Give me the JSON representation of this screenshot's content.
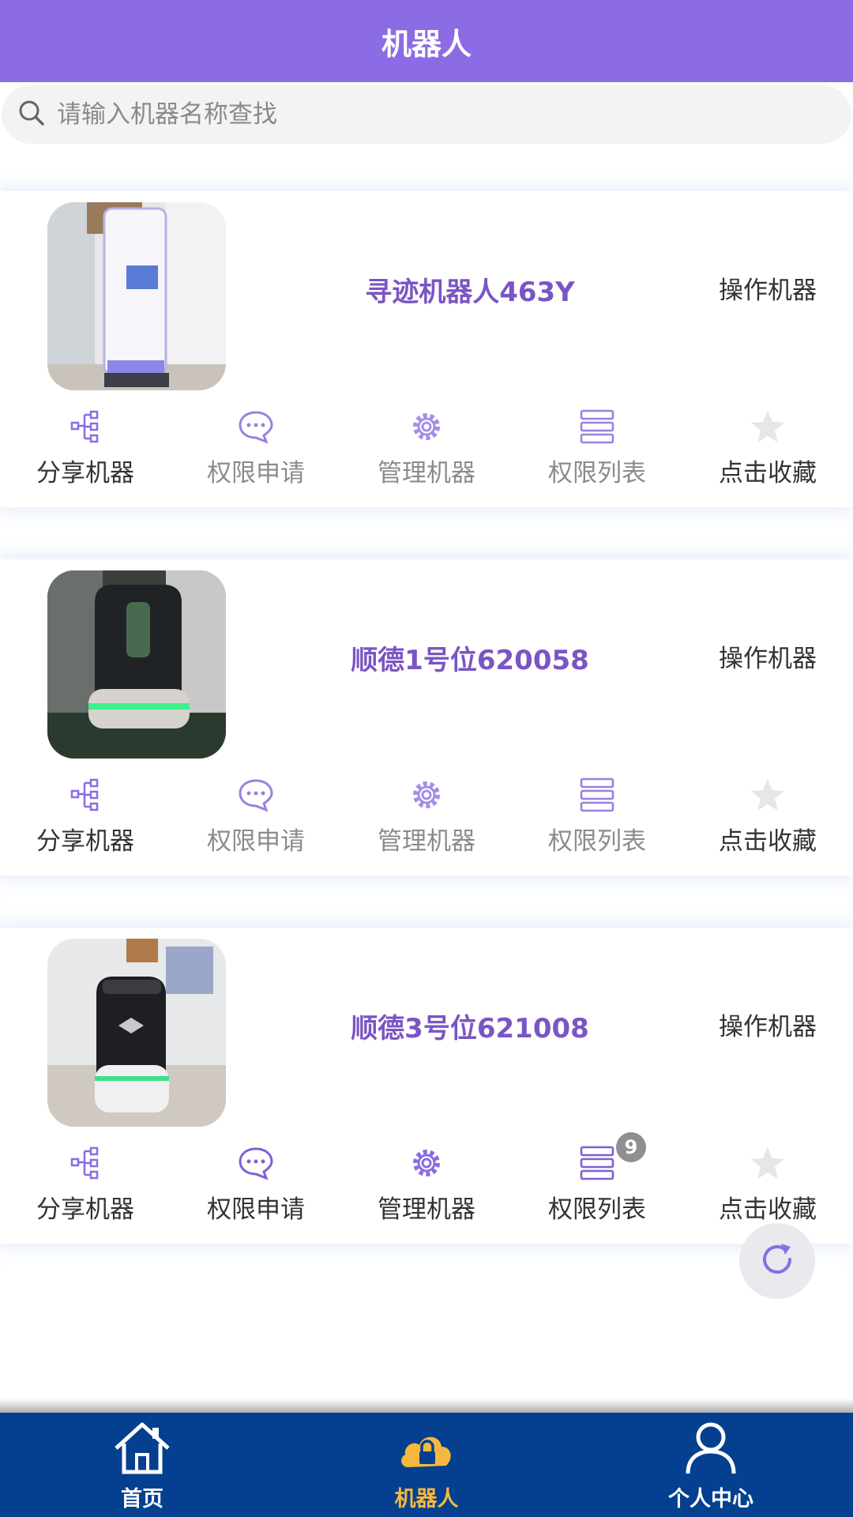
{
  "header": {
    "title": "机器人"
  },
  "search": {
    "placeholder": "请输入机器名称查找",
    "icon": "search-icon"
  },
  "colors": {
    "header": "#8b6ce4",
    "accent": "#7a55c4",
    "nav": "#04408f",
    "nav_active": "#f5b83d"
  },
  "robots": [
    {
      "name": "寻迹机器人463Y",
      "operate_label": "操作机器",
      "actions": [
        {
          "label": "分享机器",
          "icon": "share-icon",
          "tone": "dark"
        },
        {
          "label": "权限申请",
          "icon": "chat-icon",
          "tone": "gray"
        },
        {
          "label": "管理机器",
          "icon": "gear-icon",
          "tone": "gray"
        },
        {
          "label": "权限列表",
          "icon": "list-icon",
          "tone": "gray"
        },
        {
          "label": "点击收藏",
          "icon": "star-icon",
          "tone": "dark"
        }
      ]
    },
    {
      "name": "顺德1号位620058",
      "operate_label": "操作机器",
      "actions": [
        {
          "label": "分享机器",
          "icon": "share-icon",
          "tone": "dark"
        },
        {
          "label": "权限申请",
          "icon": "chat-icon",
          "tone": "gray"
        },
        {
          "label": "管理机器",
          "icon": "gear-icon",
          "tone": "gray"
        },
        {
          "label": "权限列表",
          "icon": "list-icon",
          "tone": "gray"
        },
        {
          "label": "点击收藏",
          "icon": "star-icon",
          "tone": "dark"
        }
      ]
    },
    {
      "name": "顺德3号位621008",
      "operate_label": "操作机器",
      "actions": [
        {
          "label": "分享机器",
          "icon": "share-icon",
          "tone": "dark"
        },
        {
          "label": "权限申请",
          "icon": "chat-icon",
          "tone": "dark"
        },
        {
          "label": "管理机器",
          "icon": "gear-icon",
          "tone": "dark"
        },
        {
          "label": "权限列表",
          "icon": "list-icon",
          "tone": "dark",
          "badge": "9"
        },
        {
          "label": "点击收藏",
          "icon": "star-icon",
          "tone": "dark"
        }
      ]
    }
  ],
  "refresh": {
    "icon": "refresh-icon"
  },
  "bottom_nav": [
    {
      "label": "首页",
      "icon": "home-icon",
      "active": false
    },
    {
      "label": "机器人",
      "icon": "cloud-lock-icon",
      "active": true
    },
    {
      "label": "个人中心",
      "icon": "user-icon",
      "active": false
    }
  ]
}
